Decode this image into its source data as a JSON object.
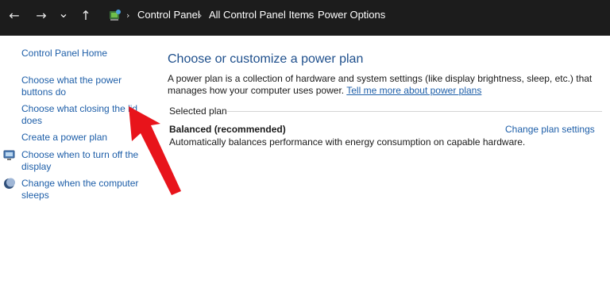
{
  "address_bar": {
    "back_glyph": "←",
    "forward_glyph": "→",
    "recent_glyph": "⌄",
    "up_glyph": "↑",
    "separator": "›",
    "breadcrumbs": [
      "Control Panel",
      "All Control Panel Items",
      "Power Options"
    ],
    "icon": "control-panel-icon"
  },
  "sidebar": {
    "home": "Control Panel Home",
    "items": [
      {
        "line1": "Choose what the power",
        "line2": "buttons do"
      },
      {
        "line1": "Choose what closing the lid",
        "line2": "does"
      },
      {
        "line1": "Create a power plan"
      },
      {
        "line1": "Choose when to turn off the",
        "line2": "display",
        "icon": "display-icon"
      },
      {
        "line1": "Change when the computer",
        "line2": "sleeps",
        "icon": "moon-icon"
      }
    ]
  },
  "main": {
    "title": "Choose or customize a power plan",
    "description": "A power plan is a collection of hardware and system settings (like display brightness, sleep, etc.) that manages how your computer uses power.",
    "learn_more_link": "Tell me more about power plans",
    "selected_plan_label": "Selected plan",
    "plan": {
      "name": "Balanced (recommended)",
      "description": "Automatically balances performance with energy consumption on capable hardware.",
      "change_link": "Change plan settings"
    }
  },
  "annotation": {
    "arrow_color": "#e8141b"
  },
  "colors": {
    "link": "#1d5ea8",
    "title": "#1e4f8c",
    "topbar": "#1c1c1c"
  }
}
